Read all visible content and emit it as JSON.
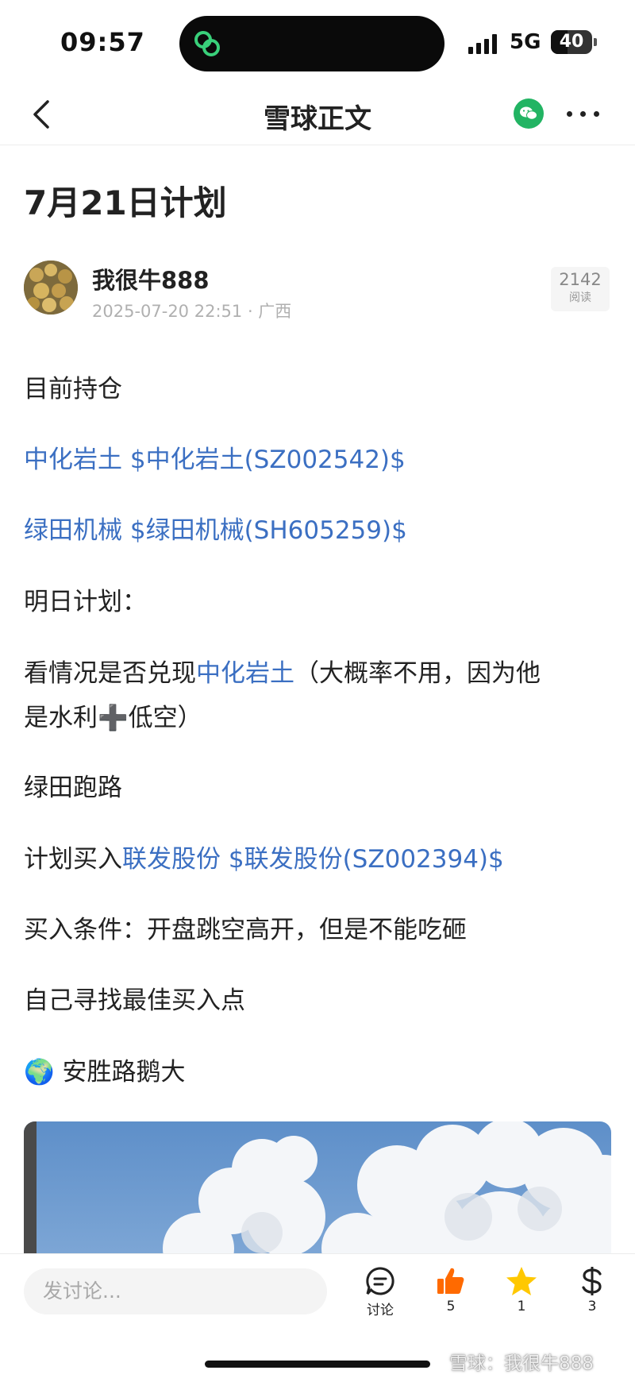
{
  "status_bar": {
    "time": "09:57",
    "network": "5G",
    "battery": "40",
    "battery_level": 0.4
  },
  "nav": {
    "title": "雪球正文"
  },
  "article": {
    "title": "7月21日计划",
    "author": "我很牛888",
    "date": "2025-07-20 22:51",
    "location": "广西",
    "reads_count": "2142",
    "reads_label": "阅读",
    "paragraphs": [
      {
        "text": "目前持仓"
      },
      {
        "link": "中化岩土",
        "link2": "$中化岩土(SZ002542)$"
      },
      {
        "link": "绿田机械",
        "link2": "$绿田机械(SH605259)$"
      },
      {
        "text": "明日计划："
      },
      {
        "pre": "看情况是否兑现",
        "link": "中化岩土",
        "post_line1": "（大概率不用，因为他",
        "post_line2_a": "是水利",
        "emoji_plus": "➕",
        "post_line2_b": "低空）"
      },
      {
        "text": "绿田跑路"
      },
      {
        "pre": "计划买入",
        "link": "联发股份",
        "link2": "$联发股份(SZ002394)$"
      },
      {
        "text": "买入条件：开盘跳空高开，但是不能吃砸"
      },
      {
        "text": "自己寻找最佳买入点"
      },
      {
        "emoji": "🌍",
        "text": "安胜路鹅大"
      }
    ]
  },
  "bottom_bar": {
    "comment_placeholder": "发讨论...",
    "discuss_label": "讨论",
    "like_count": "5",
    "star_count": "1",
    "reward_count": "3"
  },
  "watermark": "雪球：我很牛888",
  "colors": {
    "link": "#3b6fc2",
    "like": "#ff6a00",
    "star": "#ffc800",
    "wechat": "#22b463"
  },
  "icons": [
    "back-arrow-icon",
    "wechat-icon",
    "more-dots-icon",
    "discuss-icon",
    "thumbs-up-icon",
    "star-icon",
    "dollar-icon",
    "earth-globe-icon"
  ]
}
